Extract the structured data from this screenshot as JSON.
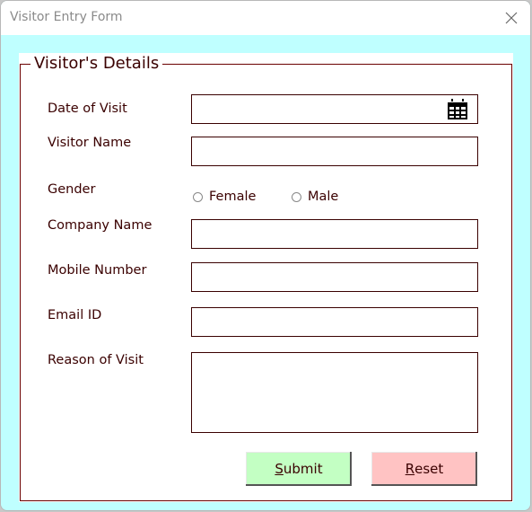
{
  "window": {
    "title": "Visitor Entry Form",
    "close_icon": "close-icon"
  },
  "form": {
    "section_title": "Visitor's Details",
    "fields": {
      "date_of_visit": {
        "label": "Date of Visit",
        "value": "",
        "icon": "calendar-icon"
      },
      "visitor_name": {
        "label": "Visitor Name",
        "value": ""
      },
      "gender": {
        "label": "Gender",
        "options": [
          "Female",
          "Male"
        ],
        "selected": null
      },
      "company_name": {
        "label": "Company Name",
        "value": ""
      },
      "mobile_number": {
        "label": "Mobile Number",
        "value": ""
      },
      "email_id": {
        "label": "Email ID",
        "value": ""
      },
      "reason_of_visit": {
        "label": "Reason of Visit",
        "value": ""
      }
    },
    "buttons": {
      "submit": {
        "accel": "S",
        "rest": "ubmit",
        "color": "#c3ffc3"
      },
      "reset": {
        "accel": "R",
        "rest": "eset",
        "color": "#ffc3c3"
      }
    }
  },
  "colors": {
    "background": "#bfffff",
    "frame_border": "#6b0000",
    "text": "#3a0000"
  }
}
